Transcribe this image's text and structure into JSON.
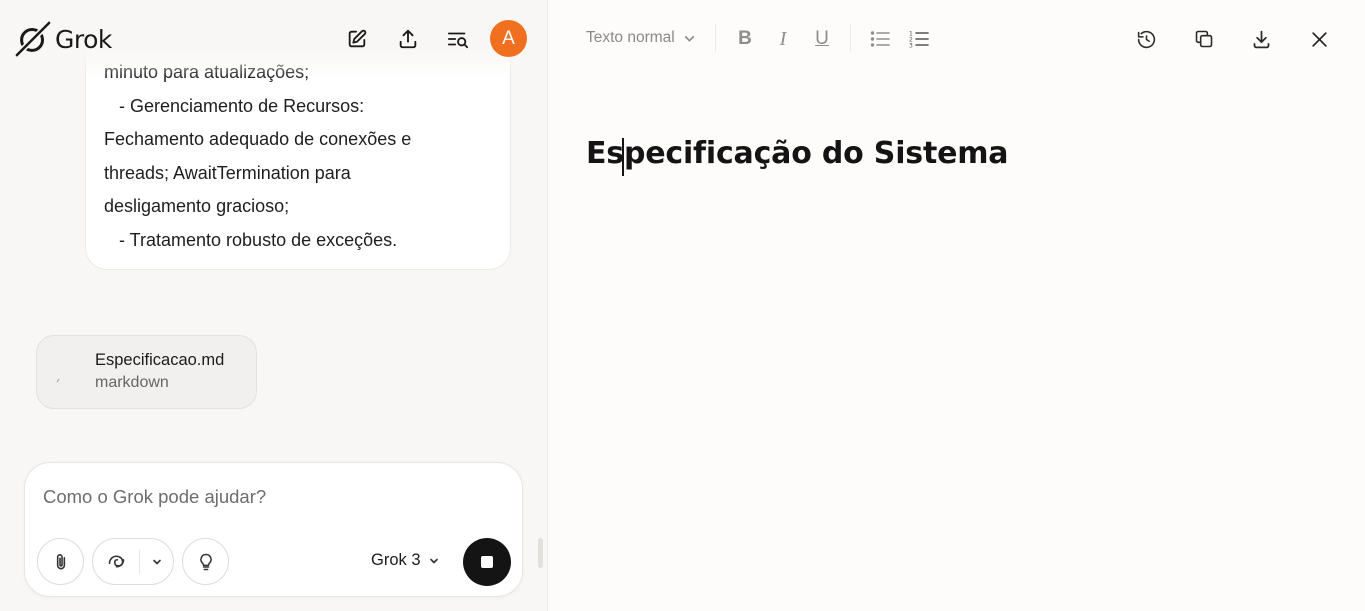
{
  "app": {
    "name": "Grok"
  },
  "header": {
    "icons": [
      "new-chat-icon",
      "share-upload-icon",
      "search-history-icon"
    ],
    "avatar_letter": "A",
    "avatar_color": "#f07020"
  },
  "chat": {
    "message_lines": [
      "minuto para atualizações;",
      "   - Gerenciamento de Recursos:",
      "Fechamento adequado de conexões e",
      "threads; AwaitTermination para",
      "desligamento gracioso;",
      "   - Tratamento robusto de exceções."
    ],
    "attachment": {
      "name": "Especificacao.md",
      "type": "markdown"
    }
  },
  "composer": {
    "placeholder": "Como o Grok pode ajudar?",
    "model": "Grok 3",
    "buttons": [
      "attach-icon",
      "deepsearch-icon",
      "think-icon",
      "stop-icon"
    ]
  },
  "editor": {
    "text_style": "Texto normal",
    "format_buttons": {
      "bold": "B",
      "italic": "I",
      "underline": "U"
    },
    "actions": [
      "history-icon",
      "copy-icon",
      "download-icon",
      "close-icon"
    ],
    "document_title": "Especificação do Sistema"
  },
  "colors": {
    "accent": "#f07020",
    "send_button": "#141414",
    "toolbar_icon": "#8e8e8e"
  }
}
